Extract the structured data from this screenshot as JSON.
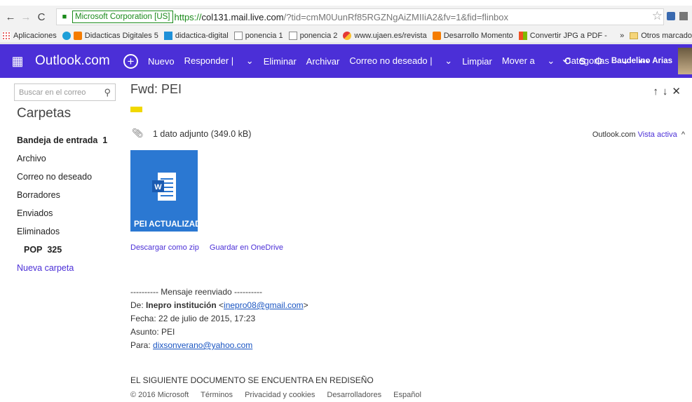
{
  "browser": {
    "ev_cert": "Microsoft Corporation [US]",
    "url_proto": "https://",
    "url_host": "col131.mail.live.com",
    "url_rest": "/?tid=cmM0UunRf85RGZNgAiZMIIiA2&fv=1&fid=flinbox",
    "bookmarks": [
      "Aplicaciones",
      "Didacticas Digitales 5",
      "didactica-digital",
      "ponencia 1",
      "ponencia 2",
      "www.ujaen.es/revista",
      "Desarrollo Momento",
      "Convertir JPG a PDF -"
    ],
    "bookmarks_more": "»",
    "other_bookmarks": "Otros marcado"
  },
  "header": {
    "brand": "Outlook.com",
    "commands": {
      "new": "Nuevo",
      "reply": "Responder |",
      "delete": "Eliminar",
      "archive": "Archivar",
      "junk": "Correo no deseado |",
      "sweep": "Limpiar",
      "move": "Mover a",
      "categories": "Categorías",
      "more": "•••"
    },
    "user": "Baudelino Arias"
  },
  "sidebar": {
    "search_placeholder": "Buscar en el correo",
    "title": "Carpetas",
    "folders": [
      {
        "label": "Bandeja de entrada",
        "count": "1"
      },
      {
        "label": "Archivo"
      },
      {
        "label": "Correo no deseado"
      },
      {
        "label": "Borradores"
      },
      {
        "label": "Enviados"
      },
      {
        "label": "Eliminados"
      },
      {
        "label": "POP",
        "count": "325"
      }
    ],
    "new_folder": "Nueva carpeta"
  },
  "message": {
    "subject": "Fwd: PEI",
    "attachments_info": "1 dato adjunto (349.0 kB)",
    "view_brand": "Outlook.com",
    "view_link": "Vista activa",
    "attachment_name": "PEI ACTUALIZADO L...",
    "download_zip": "Descargar como zip",
    "save_onedrive": "Guardar en OneDrive",
    "forwarded_header": "---------- Mensaje reenviado ----------",
    "from_label": "De:",
    "from_name": "Inepro institución",
    "from_email": "inepro08@gmail.com",
    "date_line": "Fecha: 22 de julio de 2015, 17:23",
    "subject_line": "Asunto: PEI",
    "to_label": "Para:",
    "to_email": "dixsonverano@yahoo.com",
    "body": "EL SIGUIENTE DOCUMENTO SE ENCUENTRA EN REDISEÑO"
  },
  "footer": {
    "copyright": "© 2016 Microsoft",
    "terms": "Términos",
    "privacy": "Privacidad y cookies",
    "developers": "Desarrolladores",
    "language": "Español"
  },
  "colors": {
    "brand_purple": "#4b2fd7",
    "attachment_blue": "#2b78d2"
  }
}
